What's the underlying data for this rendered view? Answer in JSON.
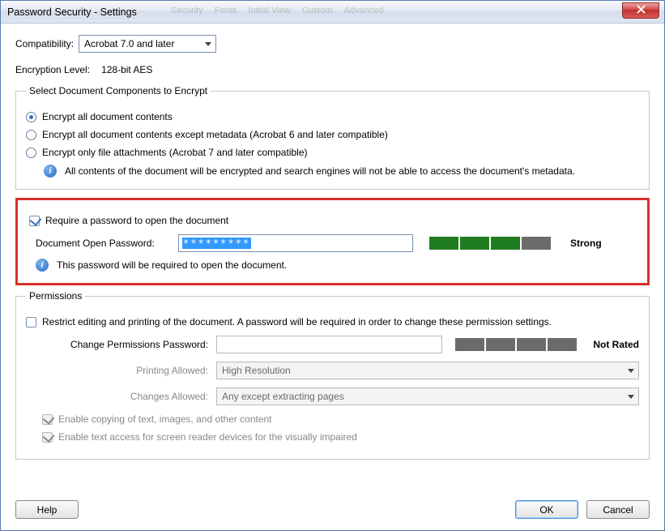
{
  "window": {
    "title": "Password Security - Settings",
    "background_tabs": [
      "Security",
      "Fonts",
      "Initial View",
      "Custom",
      "Advanced"
    ]
  },
  "compatibility": {
    "label": "Compatibility:",
    "value": "Acrobat 7.0 and later"
  },
  "encryption": {
    "label": "Encryption Level:",
    "value": "128-bit AES"
  },
  "encrypt_group": {
    "legend": "Select Document Components to Encrypt",
    "options": {
      "all": "Encrypt all document contents",
      "except_meta": "Encrypt all document contents except metadata (Acrobat 6 and later compatible)",
      "attachments": "Encrypt only file attachments (Acrobat 7 and later compatible)"
    },
    "info": "All contents of the document will be encrypted and search engines will not be able to access the document's metadata."
  },
  "open_password": {
    "require_label": "Require a password to open the document",
    "field_label": "Document Open Password:",
    "value_masked": "*********",
    "strength_label": "Strong",
    "info": "This password will be required to open the document."
  },
  "permissions": {
    "legend": "Permissions",
    "restrict_label": "Restrict editing and printing of the document. A password will be required in order to change these permission settings.",
    "change_pwd_label": "Change Permissions Password:",
    "change_pwd_strength": "Not Rated",
    "printing_label": "Printing Allowed:",
    "printing_value": "High Resolution",
    "changes_label": "Changes Allowed:",
    "changes_value": "Any except extracting pages",
    "enable_copy": "Enable copying of text, images, and other content",
    "enable_screenreader": "Enable text access for screen reader devices for the visually impaired"
  },
  "buttons": {
    "help": "Help",
    "ok": "OK",
    "cancel": "Cancel"
  }
}
